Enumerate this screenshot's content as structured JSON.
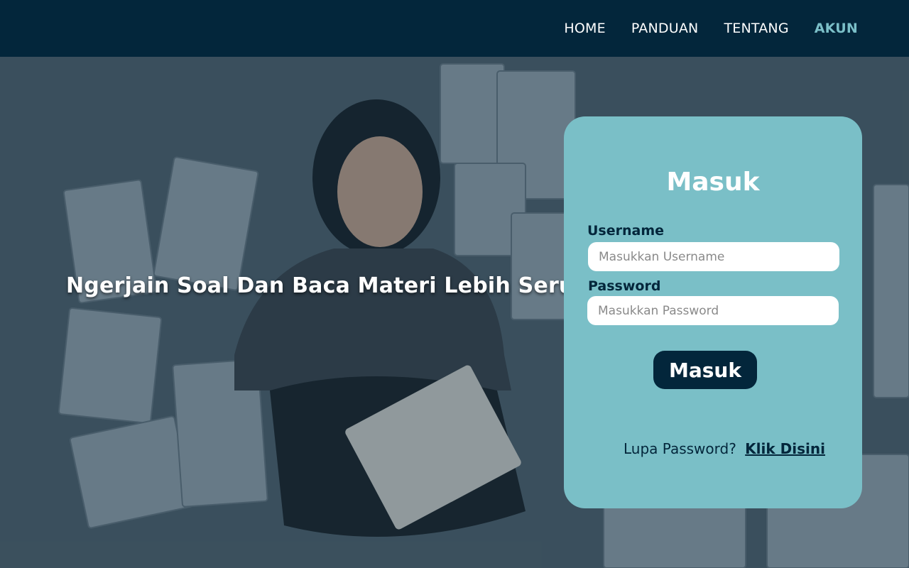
{
  "nav": {
    "items": [
      {
        "label": "HOME",
        "active": false
      },
      {
        "label": "PANDUAN",
        "active": false
      },
      {
        "label": "TENTANG",
        "active": false
      },
      {
        "label": "AKUN",
        "active": true
      }
    ]
  },
  "hero": {
    "tagline": "Ngerjain Soal Dan Baca Materi Lebih Seru"
  },
  "login": {
    "title": "Masuk",
    "username_label": "Username",
    "username_placeholder": "Masukkan Username",
    "username_value": "",
    "password_label": "Password",
    "password_placeholder": "Masukkan Password",
    "password_value": "",
    "submit_label": "Masuk",
    "forgot_text": "Lupa Password?",
    "forgot_link": "Klik Disini"
  },
  "colors": {
    "navbar_bg": "#03263b",
    "nav_active": "#7bbfc8",
    "card_bg": "#7abfc7",
    "button_bg": "#03263b"
  }
}
